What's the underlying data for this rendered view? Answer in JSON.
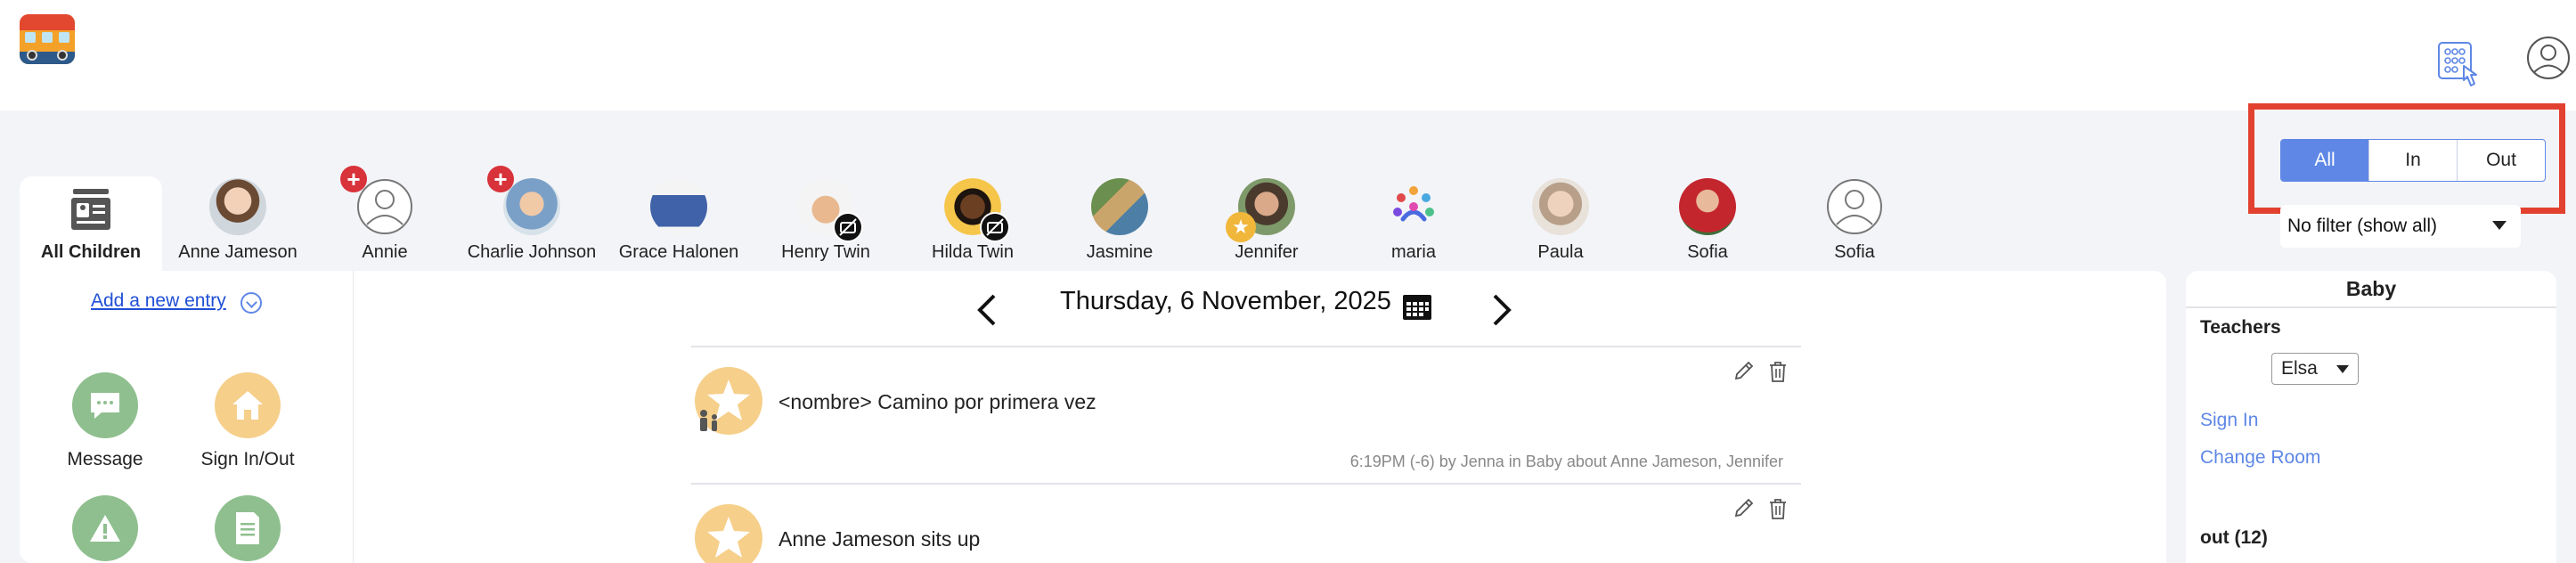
{
  "header": {
    "logo": "school-bus-logo",
    "keypad_icon": "keypad-touch-icon",
    "user_icon": "user-account-icon"
  },
  "status_filter": {
    "options": [
      "All",
      "In",
      "Out"
    ],
    "selected": "All",
    "highlight_color": "#e2412f",
    "accent_color": "#5e87e6"
  },
  "room_filter": {
    "value": "No filter (show all)"
  },
  "children": {
    "all_label": "All Children",
    "list": [
      {
        "name": "Anne Jameson",
        "avatar": "photo"
      },
      {
        "name": "Annie",
        "avatar": "placeholder",
        "badge": "plus"
      },
      {
        "name": "Charlie Johnson",
        "avatar": "photo",
        "badge": "plus"
      },
      {
        "name": "Grace Halonen",
        "avatar": "photo"
      },
      {
        "name": "Henry Twin",
        "avatar": "photo",
        "badge": "no-photo"
      },
      {
        "name": "Hilda Twin",
        "avatar": "photo",
        "badge": "no-photo"
      },
      {
        "name": "Jasmine",
        "avatar": "photo"
      },
      {
        "name": "Jennifer",
        "avatar": "photo",
        "badge": "star"
      },
      {
        "name": "maria",
        "avatar": "people-icon"
      },
      {
        "name": "Paula",
        "avatar": "photo"
      },
      {
        "name": "Sofia",
        "avatar": "photo"
      },
      {
        "name": "Sofia",
        "avatar": "placeholder"
      }
    ]
  },
  "left_panel": {
    "add_entry": "Add a new entry",
    "actions": [
      {
        "label": "Message",
        "icon": "chat-bubble-icon"
      },
      {
        "label": "Sign In/Out",
        "icon": "house-icon"
      },
      {
        "label": "",
        "icon": "warning-icon"
      },
      {
        "label": "",
        "icon": "document-icon"
      }
    ],
    "action_color_green": "#8fbf8f",
    "action_color_orange": "#f6cf8a"
  },
  "main": {
    "date": "Thursday, 6 November, 2025",
    "entries": [
      {
        "text": "<nombre> Camino por primera vez",
        "meta": "6:19PM (-6) by Jenna in Baby about Anne Jameson, Jennifer"
      },
      {
        "text": "Anne Jameson sits up",
        "meta": ""
      }
    ]
  },
  "right_panel": {
    "room": "Baby",
    "teachers_label": "Teachers",
    "teacher_selected": "Elsa",
    "sign_in": "Sign In",
    "change_room": "Change Room",
    "out_label": "out (12)"
  }
}
